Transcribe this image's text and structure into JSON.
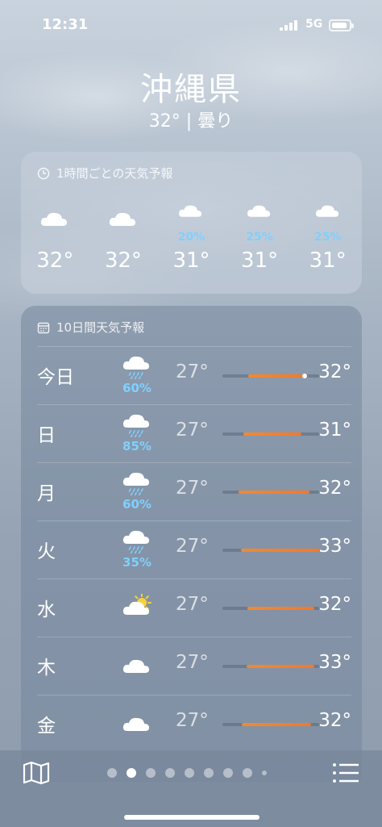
{
  "status_bar": {
    "time": "12:31",
    "network": "5G",
    "battery_level": 0.9
  },
  "location": {
    "city": "沖縄県",
    "summary": "32° | 曇り"
  },
  "hourly_card": {
    "title": "1時間ごとの天気予報",
    "icon": "clock-icon",
    "hours": [
      {
        "condition": "cloud-icon",
        "precip": "",
        "temp": "32°"
      },
      {
        "condition": "cloud-icon",
        "precip": "",
        "temp": "32°"
      },
      {
        "condition": "rain-cloud-icon",
        "precip": "20%",
        "temp": "31°"
      },
      {
        "condition": "rain-cloud-icon",
        "precip": "25%",
        "temp": "31°"
      },
      {
        "condition": "rain-cloud-icon",
        "precip": "25%",
        "temp": "31°"
      }
    ]
  },
  "daily_card": {
    "title": "10日間天気予報",
    "icon": "calendar-icon",
    "range_min": 27,
    "range_max": 33,
    "days": [
      {
        "name": "今日",
        "condition": "rain-cloud-icon",
        "precip": "60%",
        "low": "27°",
        "high": "32°",
        "bar_start": 0.27,
        "bar_end": 0.85,
        "current": 0.85
      },
      {
        "name": "日",
        "condition": "rain-cloud-icon",
        "precip": "85%",
        "low": "27°",
        "high": "31°",
        "bar_start": 0.22,
        "bar_end": 0.82,
        "current": null
      },
      {
        "name": "月",
        "condition": "rain-cloud-icon",
        "precip": "60%",
        "low": "27°",
        "high": "32°",
        "bar_start": 0.17,
        "bar_end": 0.9,
        "current": null
      },
      {
        "name": "火",
        "condition": "rain-cloud-icon",
        "precip": "35%",
        "low": "27°",
        "high": "33°",
        "bar_start": 0.19,
        "bar_end": 1.0,
        "current": null
      },
      {
        "name": "水",
        "condition": "sun-cloud-icon",
        "precip": "",
        "low": "27°",
        "high": "32°",
        "bar_start": 0.26,
        "bar_end": 0.95,
        "current": null
      },
      {
        "name": "木",
        "condition": "cloud-icon",
        "precip": "",
        "low": "27°",
        "high": "33°",
        "bar_start": 0.25,
        "bar_end": 0.95,
        "current": null
      },
      {
        "name": "金",
        "condition": "cloud-icon",
        "precip": "",
        "low": "27°",
        "high": "32°",
        "bar_start": 0.2,
        "bar_end": 0.92,
        "current": null
      }
    ]
  },
  "bottom_bar": {
    "map_icon": "map-icon",
    "list_icon": "list-icon",
    "page_count": 9,
    "active_page": 1
  },
  "colors": {
    "precip_blue": "#7fd0ff",
    "bar_orange": "#f4782a"
  }
}
